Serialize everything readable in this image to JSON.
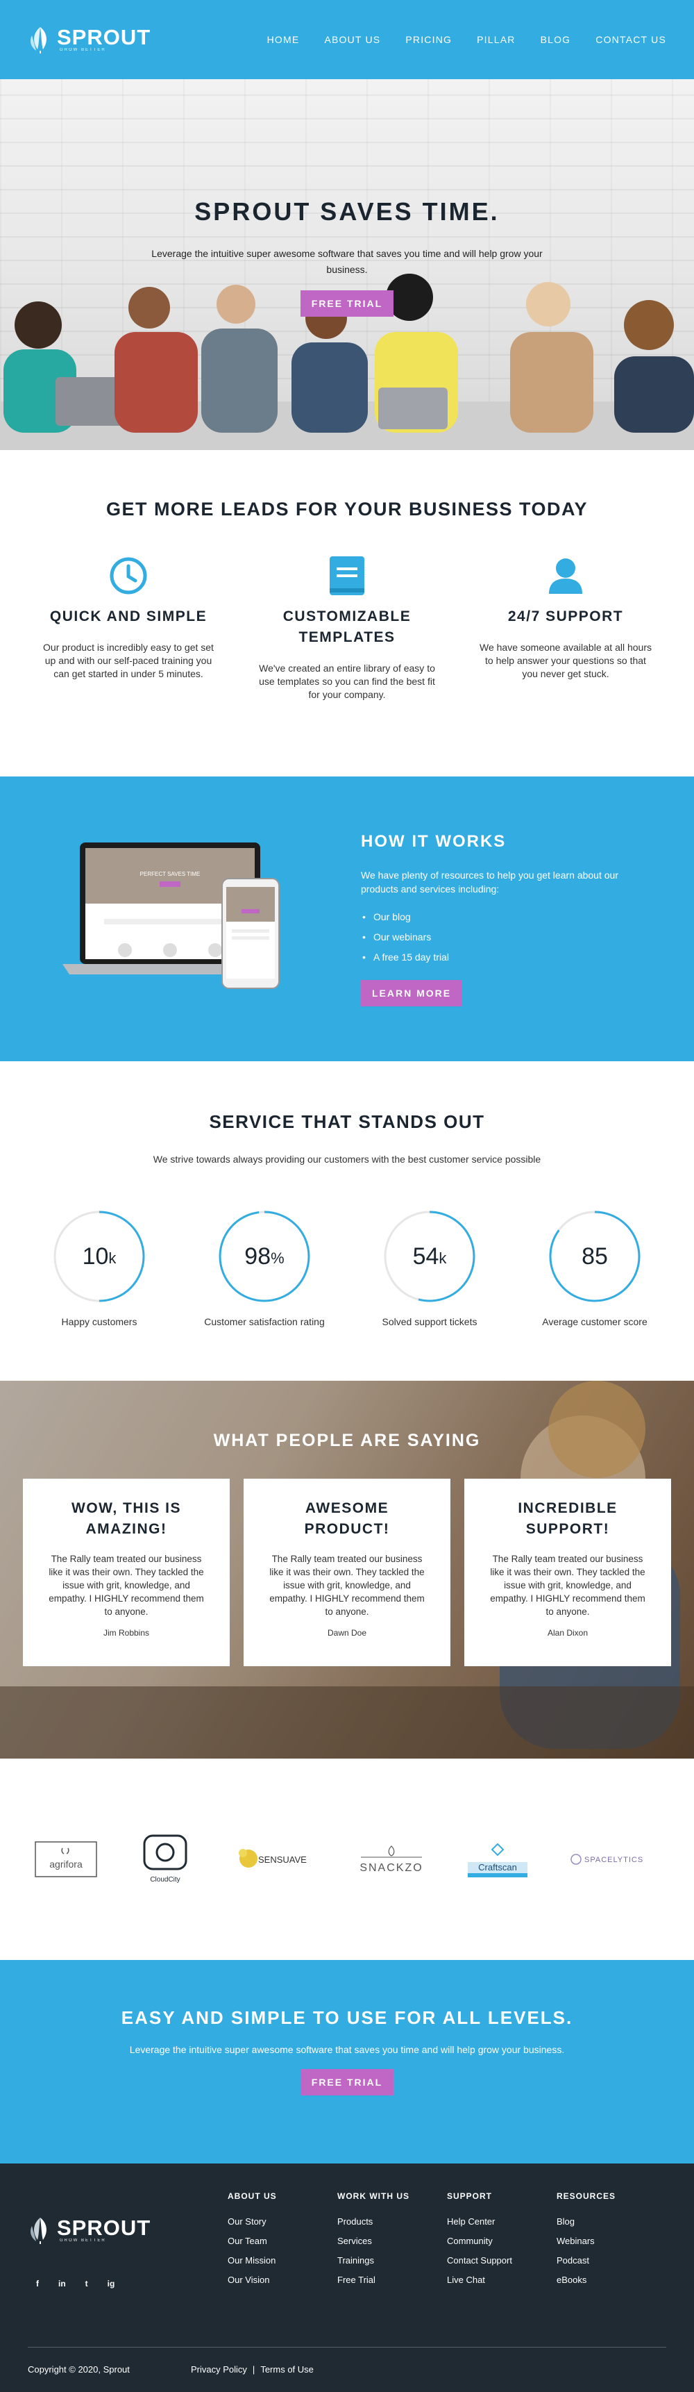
{
  "brand": {
    "name": "SPROUT",
    "tagline": "GROW BETTER"
  },
  "nav": {
    "items": [
      "HOME",
      "ABOUT US",
      "PRICING",
      "PILLAR",
      "BLOG",
      "CONTACT US"
    ]
  },
  "hero": {
    "title": "SPROUT SAVES TIME.",
    "subtitle": "Leverage the intuitive super awesome software that saves you time and will help grow your business.",
    "cta": "FREE TRIAL"
  },
  "leads": {
    "title": "GET MORE LEADS FOR YOUR BUSINESS TODAY",
    "features": [
      {
        "icon": "clock-icon",
        "title": "QUICK AND SIMPLE",
        "text": "Our product is incredibly easy to get set up and with our self-paced training you can get started in under 5 minutes."
      },
      {
        "icon": "book-icon",
        "title": "CUSTOMIZABLE TEMPLATES",
        "text": "We've created an entire library of easy to use templates so you can find the best fit for your company."
      },
      {
        "icon": "user-icon",
        "title": "24/7 SUPPORT",
        "text": "We have someone available at all hours to help answer your questions so that you never get stuck."
      }
    ]
  },
  "how": {
    "title": "HOW IT WORKS",
    "text": "We have plenty of resources to help you get learn about our products and services including:",
    "items": [
      "Our blog",
      "Our webinars",
      "A free 15 day trial"
    ],
    "cta": "LEARN MORE",
    "mock_title": "PERFECT SAVES TIME"
  },
  "service": {
    "title": "SERVICE THAT STANDS OUT",
    "subtitle": "We strive towards always providing our customers with the best customer service possible",
    "stats": [
      {
        "value": "10",
        "unit": "k",
        "label": "Happy customers",
        "progress": 0.5
      },
      {
        "value": "98",
        "unit": "%",
        "label": "Customer satisfaction rating",
        "progress": 0.98
      },
      {
        "value": "54",
        "unit": "k",
        "label": "Solved support tickets",
        "progress": 0.54
      },
      {
        "value": "85",
        "unit": "",
        "label": "Average customer score",
        "progress": 0.85
      }
    ]
  },
  "testimonials": {
    "title": "WHAT PEOPLE ARE SAYING",
    "items": [
      {
        "title": "WOW, THIS IS AMAZING!",
        "text": "The Rally team treated our business like it was their own. They tackled the issue with grit, knowledge, and empathy. I HIGHLY recommend them to anyone.",
        "author": "Jim Robbins"
      },
      {
        "title": "AWESOME PRODUCT!",
        "text": "The Rally team treated our business like it was their own. They tackled the issue with grit, knowledge, and empathy. I HIGHLY recommend them to anyone.",
        "author": "Dawn Doe"
      },
      {
        "title": "INCREDIBLE SUPPORT!",
        "text": "The Rally team treated our business like it was their own. They tackled the issue with grit, knowledge, and empathy. I HIGHLY recommend them to anyone.",
        "author": "Alan Dixon"
      }
    ]
  },
  "logos": [
    "agrifora",
    "CloudCity",
    "SENSUAVE",
    "SNACKZO",
    "Craftscan",
    "SPACELYTICS"
  ],
  "cta": {
    "title": "EASY AND SIMPLE TO USE FOR ALL LEVELS.",
    "text": "Leverage the intuitive super awesome software that saves you time and will help grow your business.",
    "button": "FREE TRIAL"
  },
  "footer": {
    "socials": [
      "f",
      "in",
      "t",
      "ig"
    ],
    "columns": [
      {
        "title": "ABOUT US",
        "links": [
          "Our Story",
          "Our Team",
          "Our Mission",
          "Our Vision"
        ]
      },
      {
        "title": "WORK WITH US",
        "links": [
          "Products",
          "Services",
          "Trainings",
          "Free Trial"
        ]
      },
      {
        "title": "SUPPORT",
        "links": [
          "Help Center",
          "Community",
          "Contact Support",
          "Live Chat"
        ]
      },
      {
        "title": "RESOURCES",
        "links": [
          "Blog",
          "Webinars",
          "Podcast",
          "eBooks"
        ]
      }
    ],
    "copyright": "Copyright © 2020, Sprout",
    "privacy": "Privacy Policy",
    "separator": "|",
    "terms": "Terms of Use"
  },
  "colors": {
    "primary": "#33ade1",
    "accent": "#c066c4",
    "dark": "#1f2a33",
    "heading": "#1b2530"
  }
}
